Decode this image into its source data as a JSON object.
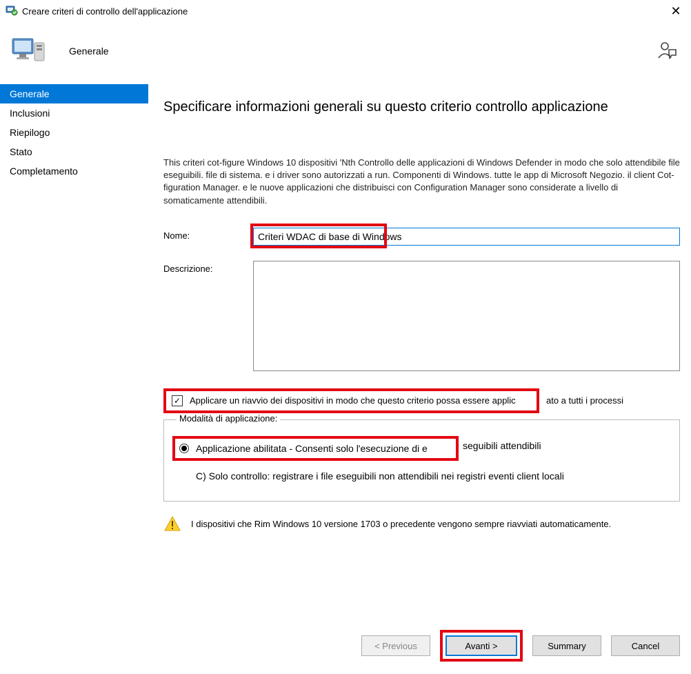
{
  "window": {
    "title": "Creare criteri di controllo dell'applicazione"
  },
  "header": {
    "page_label": "Generale"
  },
  "sidebar": {
    "items": [
      {
        "label": "Generale",
        "selected": true
      },
      {
        "label": "Inclusioni",
        "selected": false
      },
      {
        "label": "Riepilogo",
        "selected": false
      },
      {
        "label": "Stato",
        "selected": false
      },
      {
        "label": "Completamento",
        "selected": false
      }
    ]
  },
  "main": {
    "heading": "Specificare informazioni generali su questo criterio controllo applicazione",
    "intro": "This criteri cot-figure Windows 10 dispositivi 'Nth Controllo delle applicazioni di Windows Defender in modo che solo attendibile file eseguibili. file di sistema. e i driver sono autorizzati a          run. Componenti di Windows. tutte le app di Microsoft Negozio. il client Cot-figuration Manager. e le nuove applicazioni che distribuisci con Configuration Manager sono considerate a livello di somaticamente attendibili.",
    "name_label": "Nome:",
    "name_value": "Criteri WDAC di base di Windows",
    "desc_label": "Descrizione:",
    "desc_value": "",
    "checkbox_label_a": "Applicare un riavvio dei dispositivi in modo che questo criterio possa essere applic",
    "checkbox_label_b": "ato a tutti i processi",
    "checkbox_checked": true,
    "fieldset_legend": "Modalità di applicazione:",
    "radio1_a": "Applicazione abilitata - Consenti solo l'esecuzione di e",
    "radio1_b": "seguibili attendibili",
    "radio2": "C) Solo controllo: registrare i file eseguibili non attendibili nei registri eventi client locali",
    "warning": "I dispositivi che Rim Windows 10 versione 1703 o precedente vengono sempre riavviati automaticamente."
  },
  "buttons": {
    "previous": "< Previous",
    "next": "Avanti >",
    "summary": "Summary",
    "cancel": "Cancel"
  }
}
